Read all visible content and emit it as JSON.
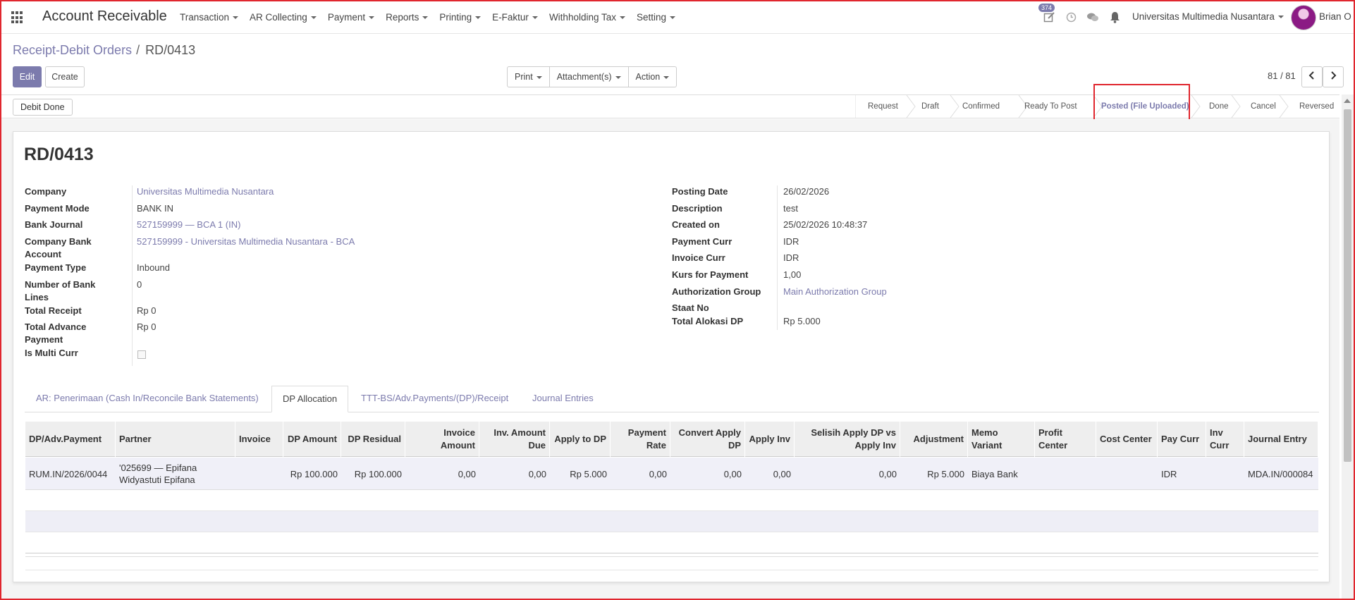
{
  "navbar": {
    "app_title": "Account Receivable",
    "menus": [
      "Transaction",
      "AR Collecting",
      "Payment",
      "Reports",
      "Printing",
      "E-Faktur",
      "Withholding Tax",
      "Setting"
    ],
    "activity_count": "374",
    "company": "Universitas Multimedia Nusantara",
    "user": "Brian O",
    "icons": [
      "apps-grid-icon",
      "edit-activity-icon",
      "clock-icon",
      "chat-icon",
      "bell-icon"
    ]
  },
  "breadcrumb": {
    "parent": "Receipt-Debit Orders",
    "separator": "/",
    "current": "RD/0413"
  },
  "toolbar": {
    "edit_label": "Edit",
    "create_label": "Create",
    "print_label": "Print",
    "attachments_label": "Attachment(s)",
    "action_label": "Action",
    "pager": "81 / 81"
  },
  "statusbar": {
    "debit_done_label": "Debit Done",
    "stages": [
      "Request",
      "Draft",
      "Confirmed",
      "Ready To Post",
      "Posted (File Uploaded)",
      "Done",
      "Cancel",
      "Reversed"
    ],
    "active_stage": "Posted (File Uploaded)"
  },
  "record": {
    "title": "RD/0413",
    "left_fields": [
      {
        "label": "Company",
        "value": "Universitas Multimedia Nusantara"
      },
      {
        "label": "Payment Mode",
        "value": "BANK IN"
      },
      {
        "label": "Bank Journal",
        "value": "527159999 — BCA 1 (IN)"
      },
      {
        "label": "Company Bank Account",
        "value": "527159999 - Universitas Multimedia Nusantara - BCA"
      },
      {
        "label": "Payment Type",
        "value": "Inbound"
      },
      {
        "label": "Number of Bank Lines",
        "value": "0"
      },
      {
        "label": "Total Receipt",
        "value": "Rp 0"
      },
      {
        "label": "Total Advance Payment",
        "value": "Rp 0"
      },
      {
        "label": "Is Multi Curr",
        "value": ""
      }
    ],
    "right_fields": [
      {
        "label": "Posting Date",
        "value": "26/02/2026"
      },
      {
        "label": "Description",
        "value": "test"
      },
      {
        "label": "Created on",
        "value": "25/02/2026 10:48:37"
      },
      {
        "label": "Payment Curr",
        "value": "IDR"
      },
      {
        "label": "Invoice Curr",
        "value": "IDR"
      },
      {
        "label": "Kurs for Payment",
        "value": "1,00"
      },
      {
        "label": "Authorization Group",
        "value": "Main Authorization Group"
      },
      {
        "label": "Staat No",
        "value": ""
      },
      {
        "label": "Total Alokasi DP",
        "value": "Rp 5.000"
      }
    ]
  },
  "tabs": [
    "AR: Penerimaan (Cash In/Reconcile Bank Statements)",
    "DP Allocation",
    "TTT-BS/Adv.Payments/(DP)/Receipt",
    "Journal Entries"
  ],
  "active_tab": "DP Allocation",
  "table": {
    "columns": [
      "DP/Adv.Payment",
      "Partner",
      "Invoice",
      "DP Amount",
      "DP Residual",
      "Invoice Amount",
      "Inv. Amount Due",
      "Apply to DP",
      "Payment Rate",
      "Convert Apply DP",
      "Apply Inv",
      "Selisih Apply DP vs Apply Inv",
      "Adjustment",
      "Memo Variant",
      "Profit Center",
      "Cost Center",
      "Pay Curr",
      "Inv Curr",
      "Journal Entry"
    ],
    "rows": [
      [
        "RUM.IN/2026/0044",
        "'025699 — Epifana Widyastuti Epifana",
        "",
        "Rp 100.000",
        "Rp 100.000",
        "0,00",
        "0,00",
        "Rp 5.000",
        "0,00",
        "0,00",
        "0,00",
        "0,00",
        "Rp 5.000",
        "Biaya Bank",
        "",
        "",
        "IDR",
        "",
        "MDA.IN/000084"
      ]
    ]
  },
  "colors": {
    "accent": "#7c7bad",
    "highlight": "#e0262e"
  }
}
